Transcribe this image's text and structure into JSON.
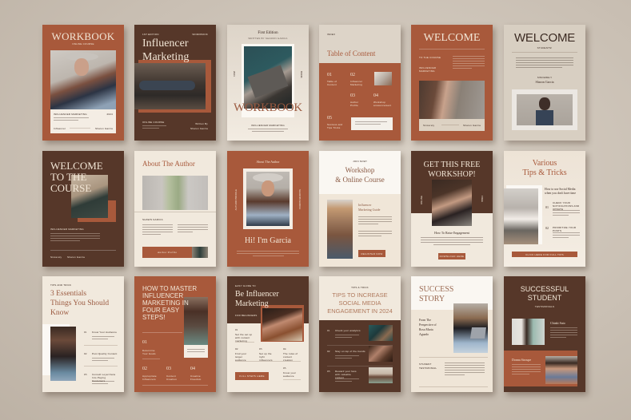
{
  "theme": {
    "rust": "#a8593b",
    "chocolate": "#563729",
    "cream": "#f1e9dd",
    "sand": "#d8cfc2",
    "background": "#cfc6ba"
  },
  "pages": [
    {
      "id": "workbook-cover",
      "title": "WORKBOOK",
      "subtitle": "ONLINE COURSE",
      "label": "INFLUENCER MARKETING",
      "year": "2024",
      "left_footer": "Influencer",
      "author": "Sharon Garcia"
    },
    {
      "id": "influencer-marketing-cover",
      "edition": "1ST EDITION",
      "tag": "WORKBOOK",
      "title_line1": "Influencer",
      "title_line2": "Marketing",
      "label": "ONLINE COURSE",
      "written_by": "Written By",
      "author": "Sharon Garcia"
    },
    {
      "id": "first-edition-cover",
      "edition": "First Edition",
      "edition_sub": "WRITTEN BY SHARON GARCIA",
      "title": "WORKBOOK",
      "side_left": "2024",
      "side_right": "BOOK",
      "label": "INFLUENCER MARKETING"
    },
    {
      "id": "table-of-content",
      "tag": "INDEX",
      "title": "Table of Content",
      "items": [
        {
          "num": "01",
          "label": "Table of Content"
        },
        {
          "num": "02",
          "label": "Influencer Marketing"
        },
        {
          "num": "03",
          "label": "Author Profile"
        },
        {
          "num": "04",
          "label": "Workshop announcement"
        },
        {
          "num": "05",
          "label": "Success and Tips Tricks"
        }
      ]
    },
    {
      "id": "welcome-rust",
      "title": "WELCOME",
      "label1": "TO THE COURSE",
      "label2": "INFLUENCER MARKETING",
      "footer_left": "Sincerely",
      "footer_right": "Sharon Garcia"
    },
    {
      "id": "welcome-sand",
      "title": "WELCOME",
      "subtitle": "STUDENTS!",
      "signature_label": "SINCERELY",
      "author": "Sharon Garcia"
    },
    {
      "id": "welcome-to-the-course",
      "title_line1": "WELCOME",
      "title_line2": "TO THE",
      "title_line3": "COURSE",
      "label": "INFLUENCER MARKETING",
      "footer_left": "Sincerely",
      "footer_right": "Sharon Garcia"
    },
    {
      "id": "about-the-author",
      "title": "About The Author",
      "name": "SHAWN GARCIA",
      "button": "Author Profile"
    },
    {
      "id": "hi-im-garcia",
      "tag": "About The Author",
      "side_left": "AUTHOR PROFILE",
      "side_right": "SHARON GARCIA",
      "title": "Hi! I'm Garcia"
    },
    {
      "id": "workshop-online-course",
      "tag": "JOIN NOW!",
      "title_line1": "Workshop",
      "title_line2": "& Online Course",
      "heading_line1": "Influencer",
      "heading_line2": "Marketing Guide",
      "button": "REGISTER NOW"
    },
    {
      "id": "get-this-free-workshop",
      "title_line1": "GET THIS FREE",
      "title_line2": "WORKSHOP!",
      "side_left": "ONLINE",
      "side_right": "FREE",
      "heading": "How To Raise Engagement",
      "button": "DOWNLOAD HERE"
    },
    {
      "id": "various-tips-tricks",
      "title_line1": "Various",
      "title_line2": "Tips & Tricks",
      "heading": "How to use Social Media when you don't have time",
      "tips": [
        {
          "num": "01",
          "label": "CHECK YOUR NOTIFICATIONS AND UPDATE"
        },
        {
          "num": "02",
          "label": "PRIORITIZE YOUR POSTS"
        }
      ],
      "button": "CLICK HERE FOR FULL TIPS"
    },
    {
      "id": "three-essentials",
      "tag": "TIPS AND TRICK",
      "title_line1": "3 Essentials",
      "title_line2": "Things You Should",
      "title_line3": "Know",
      "items": [
        {
          "num": "01",
          "label": "Know Your Audience"
        },
        {
          "num": "02",
          "label": "Post Quality Content"
        },
        {
          "num": "03",
          "label": "Consult Loyal Fans Into Paying Customers"
        }
      ]
    },
    {
      "id": "how-to-master",
      "title_line1": "HOW TO MASTER",
      "title_line2": "INFLUENCER",
      "title_line3": "MARKETING IN",
      "title_line4": "FOUR EASY",
      "title_line5": "STEPS!",
      "steps": [
        {
          "num": "01",
          "label": "Determine Your Goals"
        },
        {
          "num": "02",
          "label": "Appropriate Influencers"
        },
        {
          "num": "03",
          "label": "Content Creation"
        },
        {
          "num": "04",
          "label": "Creative Freedom"
        }
      ]
    },
    {
      "id": "be-influencer-marketing",
      "tag": "EASY GUIDE TO",
      "title_line1": "Be Influencer",
      "title_line2": "Marketing",
      "label": "FOR BEGINNERS",
      "steps": [
        {
          "num": "01",
          "label": "Set the set up with content marketing"
        },
        {
          "num": "02",
          "label": "Find your target audience"
        },
        {
          "num": "03",
          "label": "Set up the right influencers"
        },
        {
          "num": "04",
          "label": "The rules of content creation"
        },
        {
          "num": "05",
          "label": "Know your audience"
        }
      ],
      "button": "FULL STEPS HERE"
    },
    {
      "id": "tips-to-increase",
      "tag": "TIPS & TRICK",
      "title_line1": "TIPS TO INCREASE",
      "title_line2": "SOCIAL MEDIA",
      "title_line3": "ENGAGEMENT IN 2024",
      "tips": [
        {
          "num": "01",
          "label": "Check your analytics"
        },
        {
          "num": "02",
          "label": "Stay on top of the trends"
        },
        {
          "num": "03",
          "label": "Reward your fans with valuable content"
        }
      ]
    },
    {
      "id": "success-story",
      "title_line1": "SUCCESS",
      "title_line2": "STORY",
      "quote_line1": "From The",
      "quote_line2": "Perspective of",
      "quote_line3": "Rosa Maria",
      "quote_line4": "Aguado",
      "label_line1": "STUDENT",
      "label_line2": "TESTIMONIAL"
    },
    {
      "id": "successful-student",
      "title_line1": "SUCCESSFUL",
      "title_line2": "STUDENT",
      "subtitle": "TESTIMONIALS",
      "student1": "Chiaki Sato",
      "student2": "Donna Stroupe"
    }
  ]
}
